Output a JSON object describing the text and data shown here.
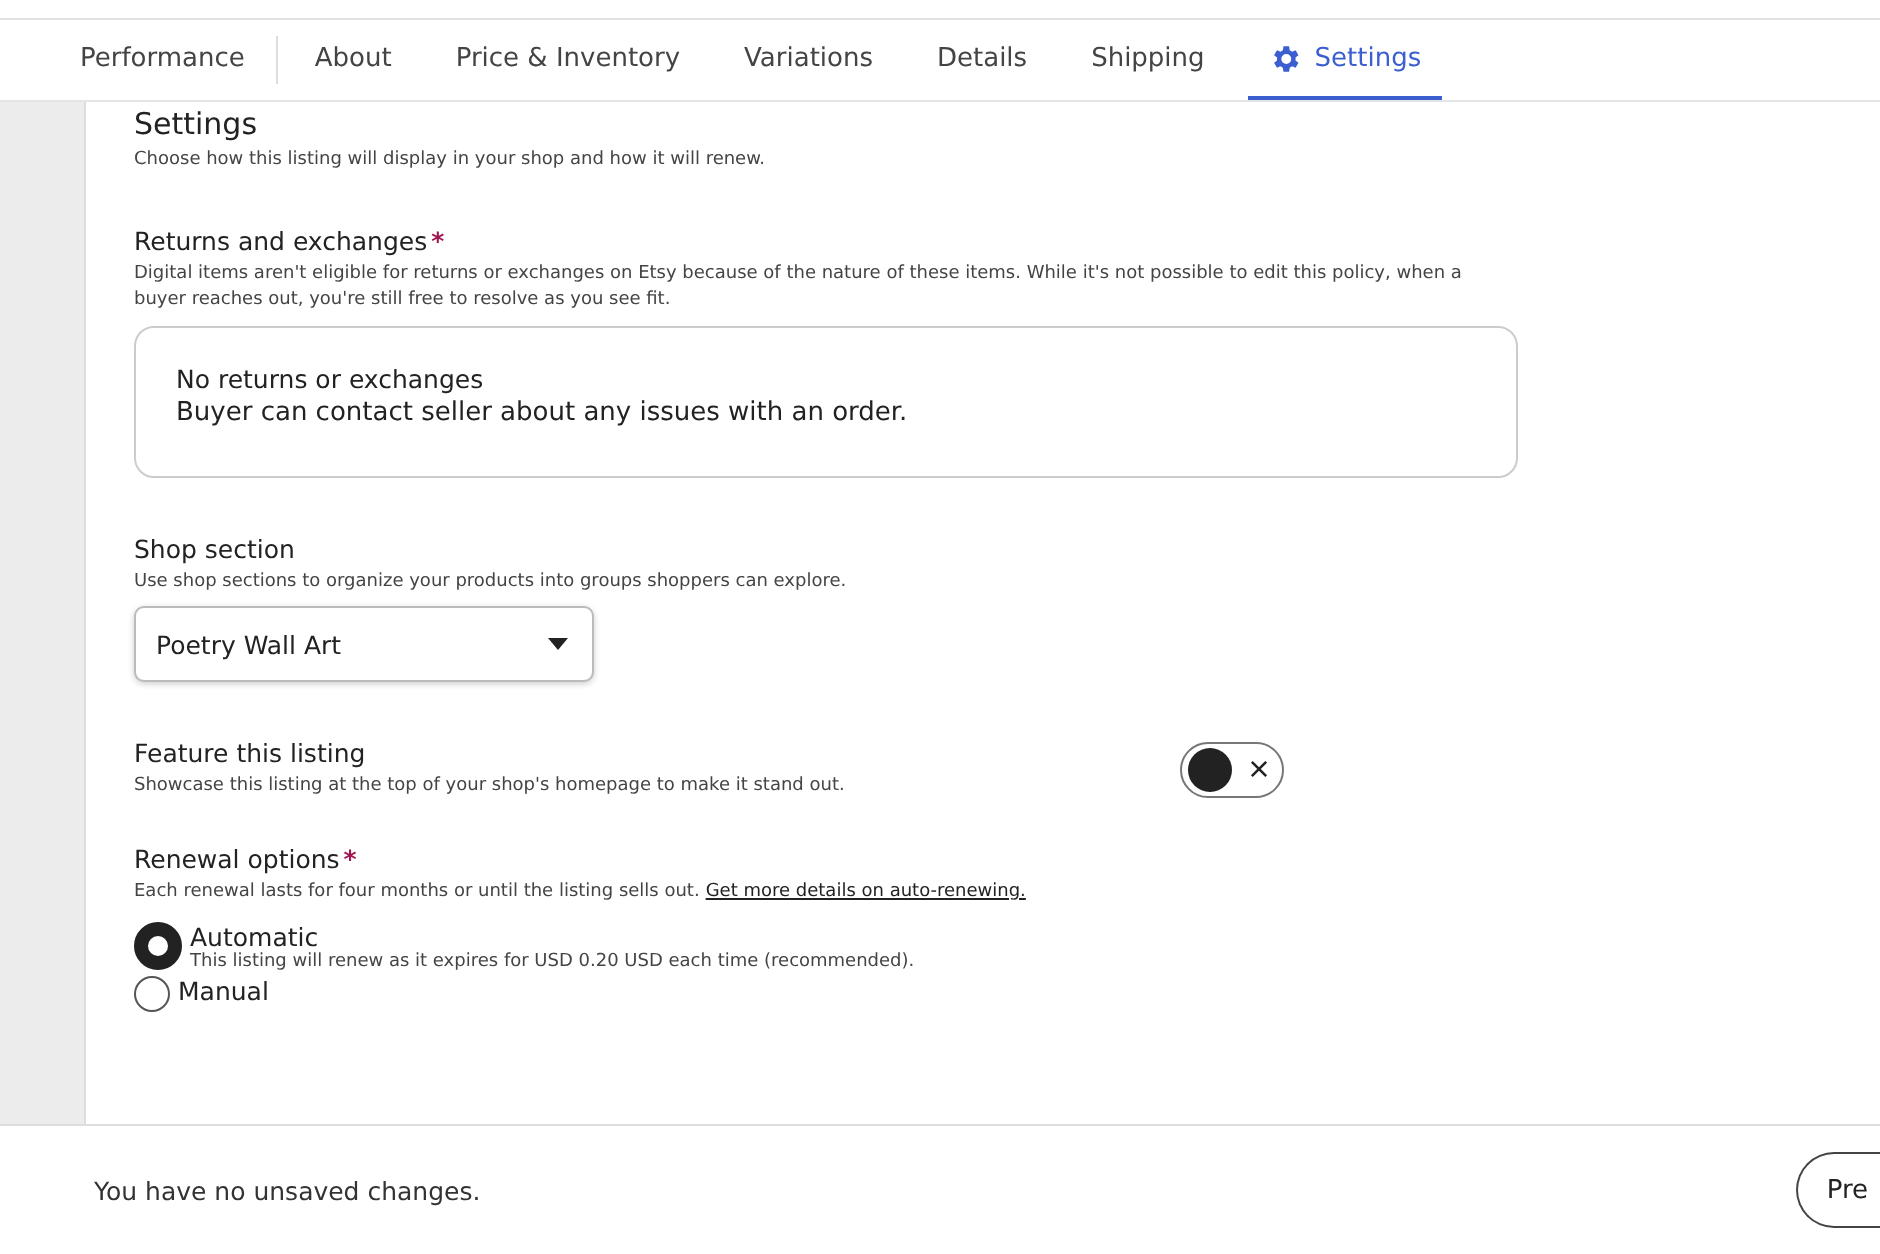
{
  "tabs": [
    {
      "label": "Performance",
      "selected": false,
      "has_icon": false
    },
    {
      "label": "About",
      "selected": false,
      "has_icon": false
    },
    {
      "label": "Price & Inventory",
      "selected": false,
      "has_icon": false
    },
    {
      "label": "Variations",
      "selected": false,
      "has_icon": false
    },
    {
      "label": "Details",
      "selected": false,
      "has_icon": false
    },
    {
      "label": "Shipping",
      "selected": false,
      "has_icon": false
    },
    {
      "label": "Settings",
      "selected": true,
      "has_icon": true
    }
  ],
  "settings": {
    "title": "Settings",
    "description": "Choose how this listing will display in your shop and how it will renew."
  },
  "returns": {
    "label": "Returns and exchanges",
    "required_mark": "*",
    "description": "Digital items aren't eligible for returns or exchanges on Etsy because of the nature of these items. While it's not possible to edit this policy, when a buyer reaches out, you're still free to resolve as you see fit.",
    "policy_title": "No returns or exchanges",
    "policy_text": "Buyer can contact seller about any issues with an order."
  },
  "shop_section": {
    "label": "Shop section",
    "description": "Use shop sections to organize your products into groups shoppers can explore.",
    "value": "Poetry Wall Art"
  },
  "feature": {
    "label": "Feature this listing",
    "description": "Showcase this listing at the top of your shop's homepage to make it stand out.",
    "on": false
  },
  "renewal": {
    "label": "Renewal options",
    "required_mark": "*",
    "description": "Each renewal lasts for four months or until the listing sells out.",
    "link": "Get more details on auto-renewing.",
    "options": [
      {
        "label": "Automatic",
        "description": "This listing will renew as it expires for USD 0.20 USD each time (recommended).",
        "selected": true
      },
      {
        "label": "Manual",
        "selected": false
      }
    ]
  },
  "footer": {
    "status": "You have no unsaved changes.",
    "button": "Pre"
  }
}
